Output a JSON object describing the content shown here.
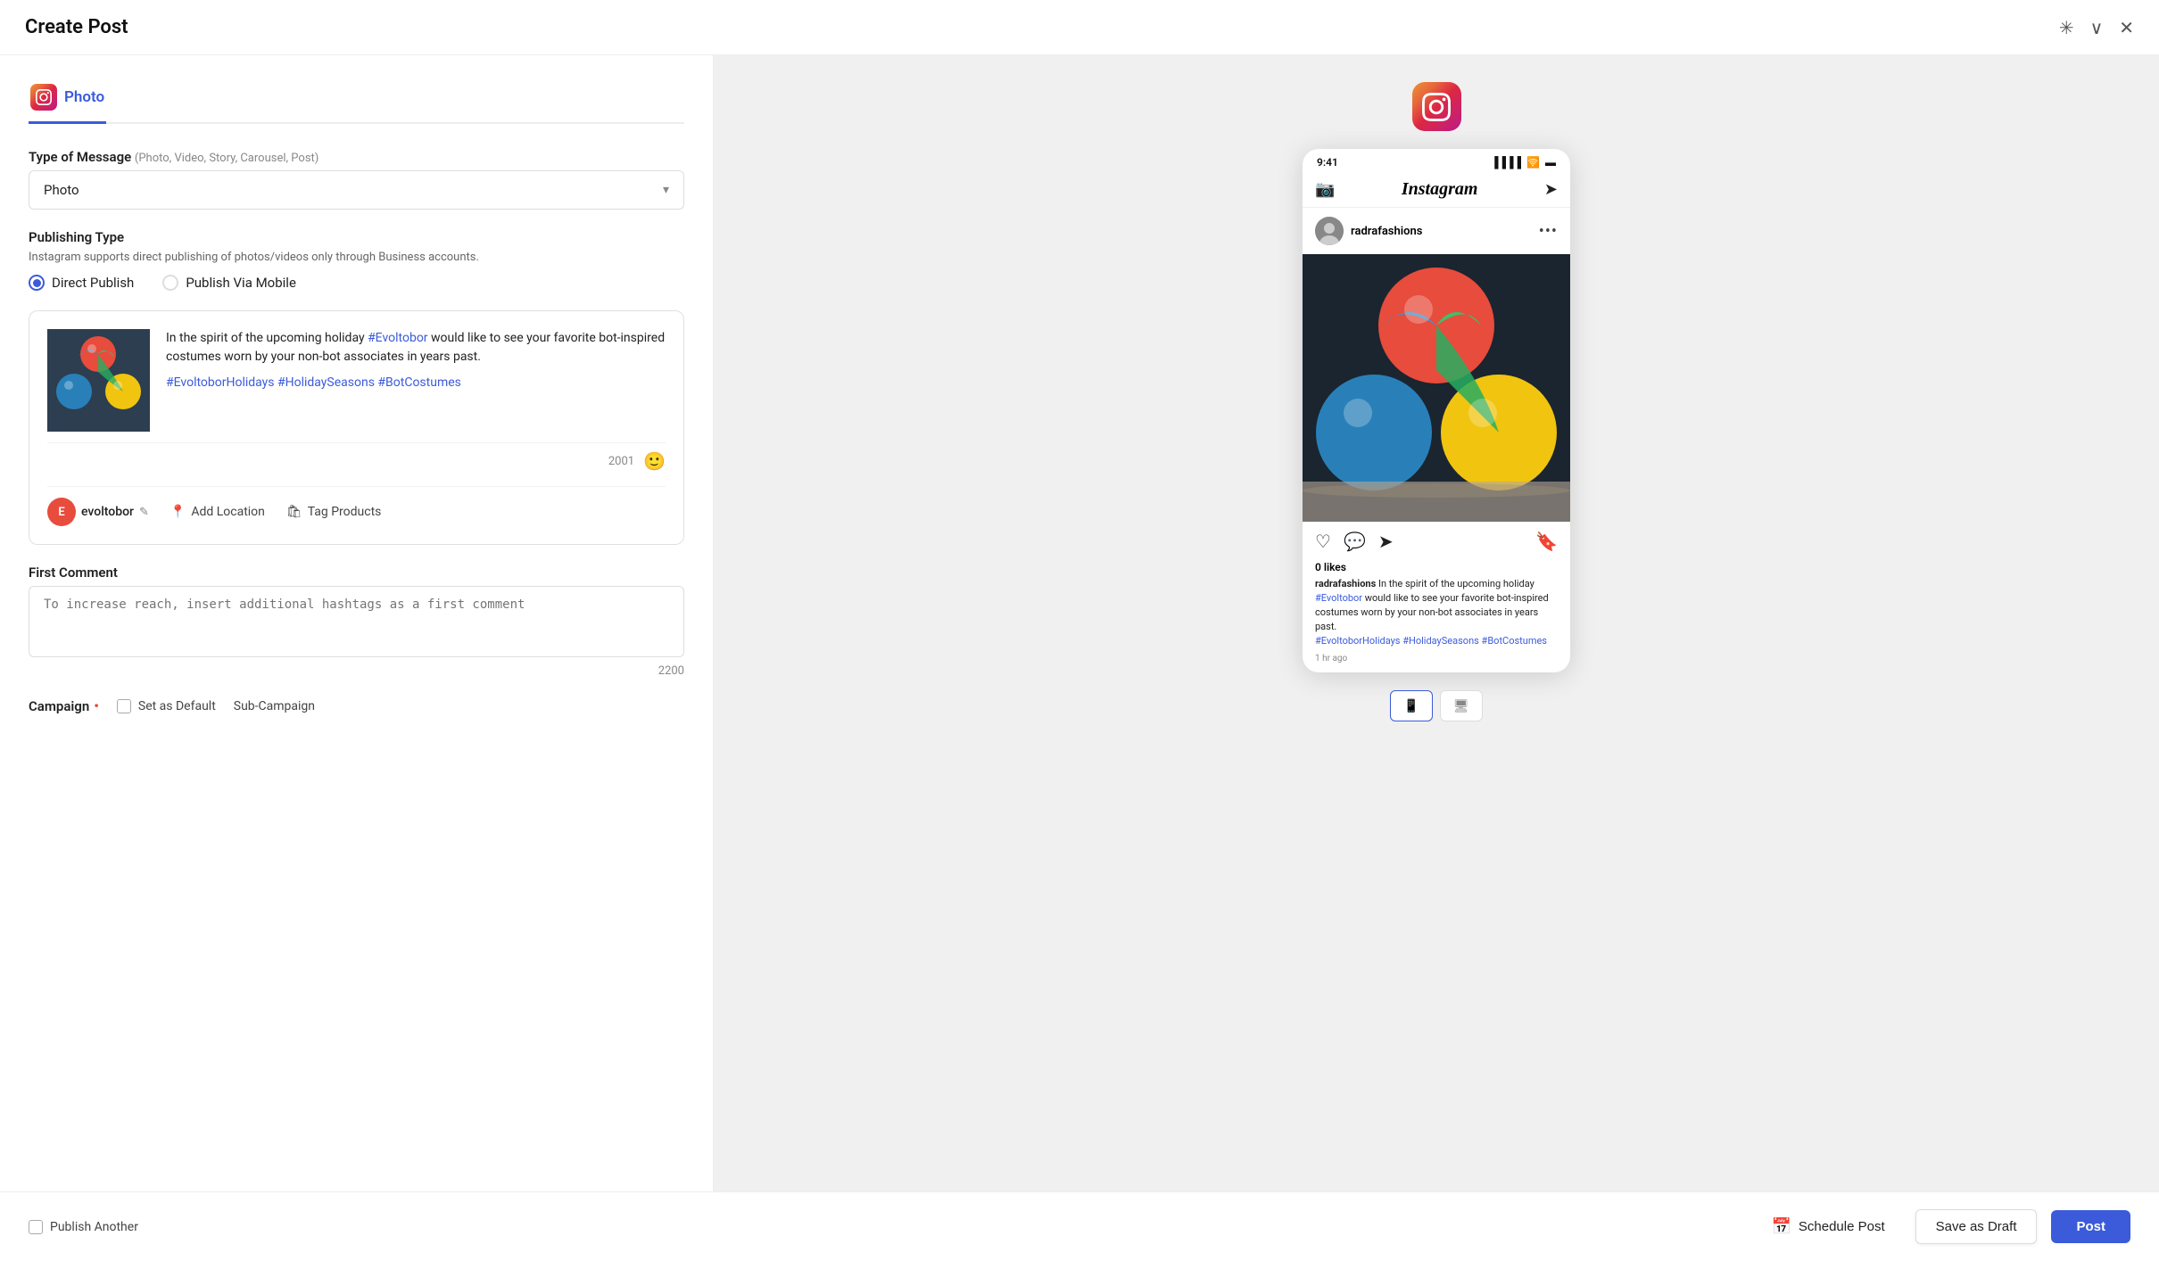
{
  "topbar": {
    "title": "Create Post",
    "pin_icon": "✳",
    "chevron_icon": "∨",
    "close_icon": "✕"
  },
  "tabs": [
    {
      "id": "photo",
      "label": "Photo",
      "active": true
    }
  ],
  "form": {
    "type_of_message_label": "Type of Message",
    "type_of_message_hint": "(Photo, Video, Story, Carousel, Post)",
    "message_type_selected": "Photo",
    "publishing_type_label": "Publishing Type",
    "publishing_type_desc": "Instagram supports direct publishing of photos/videos only through Business accounts.",
    "direct_publish_label": "Direct Publish",
    "publish_via_mobile_label": "Publish Via Mobile",
    "post_caption": "In the spirit of the upcoming holiday #Evoltobor would like to see your favorite bot-inspired costumes worn by your non-bot associates in years past.",
    "post_hashtags": "#EvoltoborHolidays #HolidaySeasons #BotCostumes",
    "post_mention": "#Evoltobor",
    "char_count": "2001",
    "account_name": "evoltobor",
    "account_edit": "✎",
    "add_location_label": "Add Location",
    "tag_products_label": "Tag Products",
    "first_comment_label": "First Comment",
    "first_comment_placeholder": "To increase reach, insert additional hashtags as a first comment",
    "comment_char_count": "2200",
    "campaign_label": "Campaign",
    "set_as_default_label": "Set as Default",
    "sub_campaign_label": "Sub-Campaign"
  },
  "preview": {
    "time": "9:41",
    "username": "radrafashions",
    "likes": "0 likes",
    "caption_user": "radrafashions",
    "caption_text": " In the spirit of the upcoming holiday ",
    "caption_mention": "#Evoltobor",
    "caption_rest": " would like to see your favorite bot-inspired costumes worn by your non-bot associates in years past.",
    "caption_hashtags": "#EvoltoborHolidays #HolidaySeasons #BotCostumes",
    "time_ago": "1 hr ago"
  },
  "bottom_bar": {
    "publish_another_label": "Publish Another",
    "schedule_post_label": "Schedule Post",
    "save_draft_label": "Save as Draft",
    "post_label": "Post"
  }
}
